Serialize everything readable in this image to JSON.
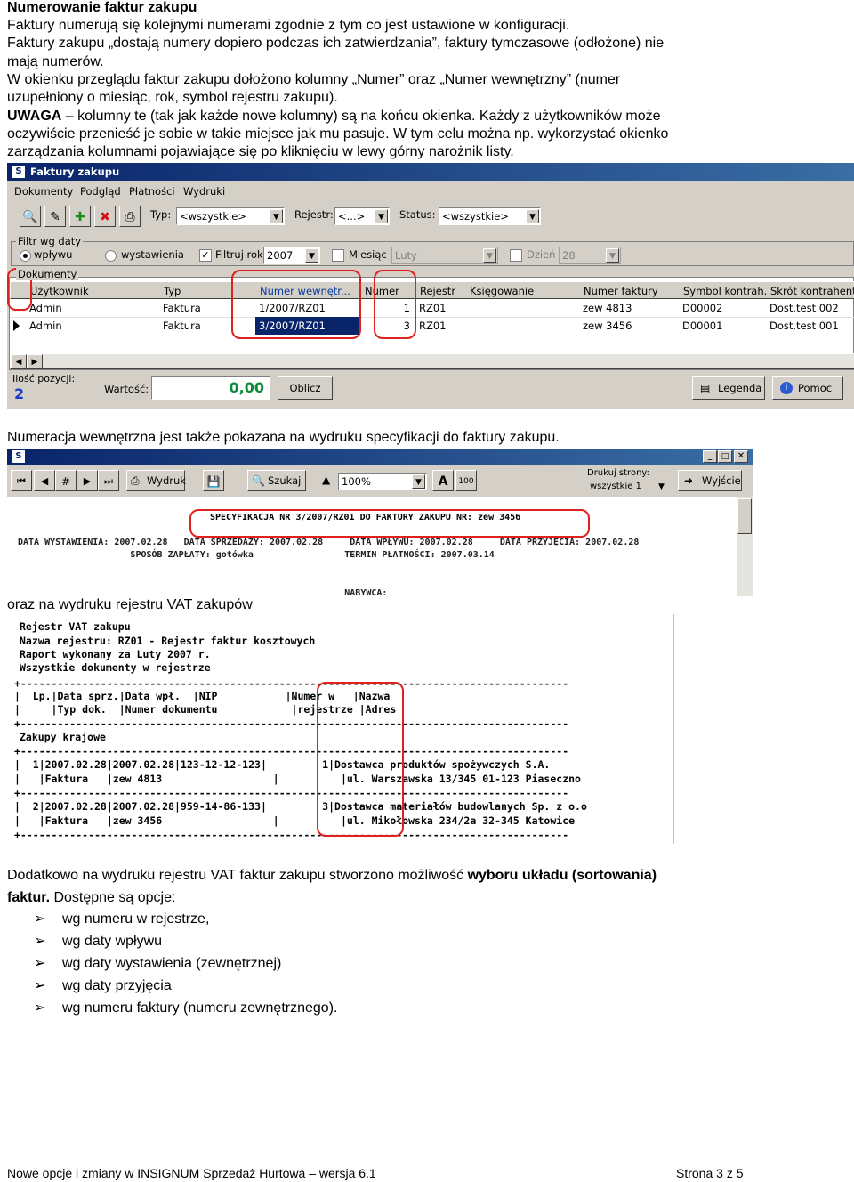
{
  "doc": {
    "heading": "Numerowanie faktur zakupu",
    "lines": [
      "Faktury numerują się kolejnymi numerami zgodnie z tym co jest ustawione w konfiguracji.",
      "Faktury zakupu „dostają numery dopiero podczas ich zatwierdzania”, faktury tymczasowe (odłożone) nie",
      "mają numerów.",
      "W okienku przeglądu faktur zakupu dołożono kolumny „Numer” oraz „Numer wewnętrzny” (numer",
      "uzupełniony o miesiąc, rok, symbol rejestru zakupu).",
      "kolumny te (tak jak każde nowe kolumny) są na końcu okienka. Każdy z użytkowników może",
      "oczywiście przenieść je sobie w takie miejsce jak mu pasuje. W tym celu można np. wykorzystać okienko",
      "zarządzania kolumnami pojawiające się po kliknięciu w lewy górny narożnik listy."
    ],
    "uwaga": "UWAGA",
    "uwaga_dash": " – ",
    "caption1": "Numeracja wewnętrzna jest także pokazana na wydruku specyfikacji do faktury zakupu.",
    "caption2": "oraz na wydruku rejestru VAT zakupów",
    "para3_a": "Dodatkowo na wydruku rejestru VAT faktur zakupu stworzono możliwość ",
    "para3_b": "wyboru układu (sortowania)",
    "para3_c": "faktur.",
    "para3_d": " Dostępne są opcje:",
    "options": [
      "wg numeru w rejestrze,",
      "wg daty wpływu",
      "wg daty wystawienia (zewnętrznej)",
      "wg daty przyjęcia",
      "wg numeru faktury (numeru zewnętrznego)."
    ],
    "footer_left": "Nowe opcje i zmiany w INSIGNUM Sprzedaż Hurtowa – wersja  6.1",
    "footer_right": "Strona 3 z 5"
  },
  "window1": {
    "title": "Faktury zakupu",
    "menu": [
      "Dokumenty",
      "Podgląd",
      "Płatności",
      "Wydruki"
    ],
    "toolbar": {
      "typ_label": "Typ:",
      "typ_value": "<wszystkie>",
      "rejestr_label": "Rejestr:",
      "rejestr_value": "<...>",
      "status_label": "Status:",
      "status_value": "<wszystkie>"
    },
    "filter": {
      "group_label": "Filtr wg daty",
      "opt_wplywu": "wpływu",
      "opt_wystawienia": "wystawienia",
      "filtruj_rok": "Filtruj rok",
      "rok": "2007",
      "miesiac": "Miesiąc",
      "miesiac_value": "Luty",
      "dzien": "Dzień",
      "dzien_value": "28"
    },
    "docs_label": "Dokumenty",
    "columns": [
      "Użytkownik",
      "Typ",
      "Numer wewnętr...",
      "Numer",
      "Rejestr",
      "Księgowanie",
      "Numer faktury",
      "Symbol kontrah...",
      "Skrót kontrahenta"
    ],
    "rows": [
      [
        "Admin",
        "Faktura",
        "1/2007/RZ01",
        "1",
        "RZ01",
        "",
        "zew 4813",
        "D00002",
        "Dost.test 002"
      ],
      [
        "Admin",
        "Faktura",
        "3/2007/RZ01",
        "3",
        "RZ01",
        "",
        "zew 3456",
        "D00001",
        "Dost.test 001"
      ]
    ],
    "footer": {
      "ilosc_label": "Ilość pozycji:",
      "ilosc_value": "2",
      "wartosc_label": "Wartość:",
      "wartosc_value": "0,00",
      "oblicz": "Oblicz",
      "legenda": "Legenda",
      "pomoc": "Pomoc"
    }
  },
  "window2": {
    "wydruk": "Wydruk",
    "szukaj": "Szukaj",
    "zoom": "100%",
    "drukuj_label": "Drukuj strony:",
    "drukuj_value": "wszystkie 1",
    "wyjscie": "Wyjście",
    "spec_line": "SPECYFIKACJA NR 3/2007/RZ01 DO FAKTURY ZAKUPU NR: zew 3456",
    "row1": "DATA WYSTAWIENIA: 2007.02.28   DATA SPRZEDAŻY: 2007.02.28     DATA WPŁYWU: 2007.02.28     DATA PRZYJĘCIA: 2007.02.28",
    "row2": "                     SPOSÓB ZAPŁATY: gotówka                 TERMIN PŁATNOŚCI: 2007.03.14",
    "row3": "                                                             NABYWCA:"
  },
  "report": {
    "lines": [
      "Rejestr VAT zakupu",
      "Nazwa rejestru: RZ01 - Rejestr faktur kosztowych",
      "Raport wykonany za Luty 2007 r.",
      "Wszystkie dokumenty w rejestrze",
      "+-----------------------------------------------------------------------------------------",
      "|  Lp.|Data sprz.|Data wpł.  |NIP           |Numer w   |Nazwa",
      "|     |Typ dok.  |Numer dokumentu            |rejestrze |Adres",
      "+-----------------------------------------------------------------------------------------",
      "Zakupy krajowe",
      "+-----------------------------------------------------------------------------------------",
      "|  1|2007.02.28|2007.02.28|123-12-12-123|         1|Dostawca produktów spożywczych S.A.",
      "|   |Faktura   |zew 4813                  |          |ul. Warszawska 13/345 01-123 Piaseczno",
      "+-----------------------------------------------------------------------------------------",
      "|  2|2007.02.28|2007.02.28|959-14-86-133|         3|Dostawca materiałów budowlanych Sp. z o.o",
      "|   |Faktura   |zew 3456                  |          |ul. Mikołowska 234/2a 32-345 Katowice",
      "+-----------------------------------------------------------------------------------------"
    ]
  }
}
